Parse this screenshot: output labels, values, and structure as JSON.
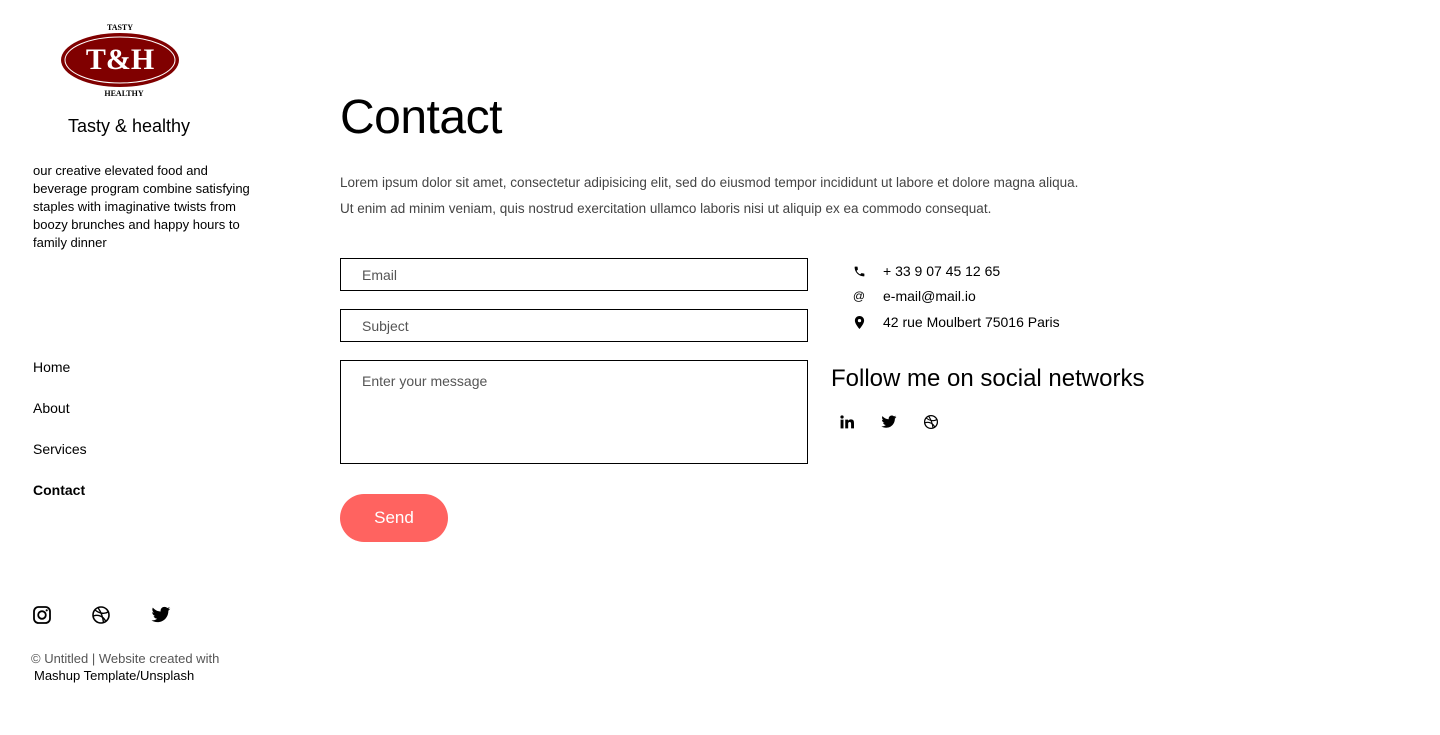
{
  "brand": {
    "logo_text_top": "TASTY",
    "logo_monogram": "T&H",
    "logo_text_bottom": "HEALTHY",
    "name": "Tasty & healthy",
    "tagline": "our creative elevated food and beverage program combine satisfying staples with imaginative twists from boozy brunches and happy hours to family dinner",
    "logo_color": "#800000"
  },
  "nav": {
    "items": [
      {
        "label": "Home",
        "active": false
      },
      {
        "label": "About",
        "active": false
      },
      {
        "label": "Services",
        "active": false
      },
      {
        "label": "Contact",
        "active": true
      }
    ]
  },
  "sidebar_social": [
    "instagram-icon",
    "dribbble-icon",
    "twitter-icon"
  ],
  "footer": {
    "copyright": "© Untitled | Website created with",
    "credit": "Mashup Template/Unsplash"
  },
  "main": {
    "title": "Contact",
    "intro_line1": "Lorem ipsum dolor sit amet, consectetur adipisicing elit, sed do eiusmod tempor incididunt ut labore et dolore magna aliqua.",
    "intro_line2": "Ut enim ad minim veniam, quis nostrud exercitation ullamco laboris nisi ut aliquip ex ea commodo consequat."
  },
  "form": {
    "email_placeholder": "Email",
    "subject_placeholder": "Subject",
    "message_placeholder": "Enter your message",
    "send_label": "Send",
    "send_color": "#ff6360"
  },
  "contact_info": {
    "phone": "+ 33 9 07 45 12 65",
    "email": "e-mail@mail.io",
    "address": "42 rue Moulbert 75016 Paris"
  },
  "social": {
    "heading": "Follow me on social networks",
    "icons": [
      "linkedin-icon",
      "twitter-icon",
      "dribbble-icon"
    ]
  }
}
